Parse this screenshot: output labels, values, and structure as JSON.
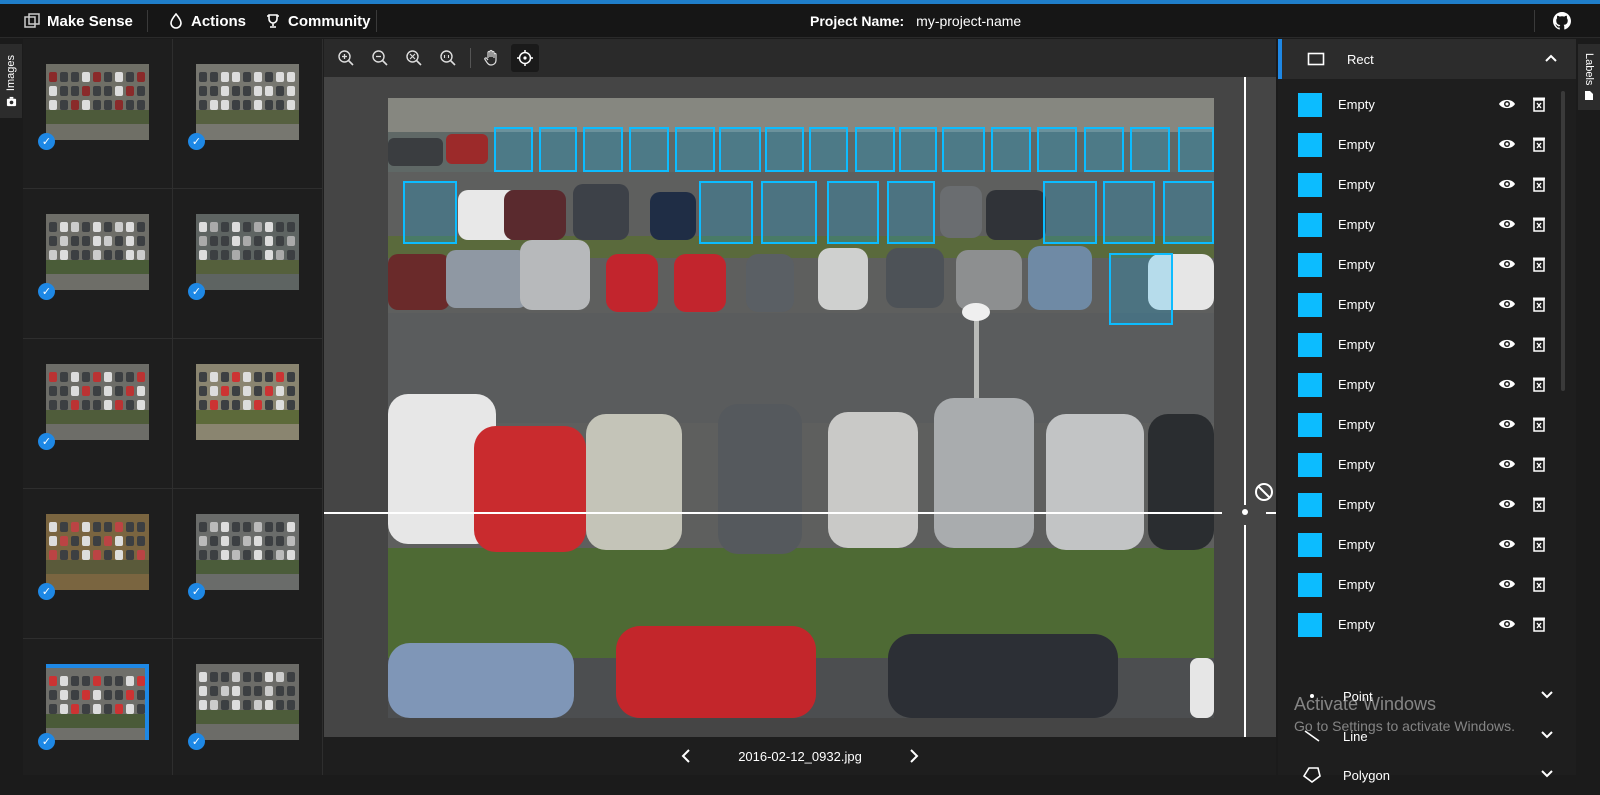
{
  "topbar": {
    "brand": "Make Sense",
    "actions": "Actions",
    "community": "Community",
    "project_label": "Project Name:",
    "project_value": "my-project-name"
  },
  "left_tab": {
    "label": "Images"
  },
  "right_tab": {
    "label": "Labels"
  },
  "thumbnails": [
    {
      "checked": true,
      "selected": false
    },
    {
      "checked": true,
      "selected": false
    },
    {
      "checked": true,
      "selected": false
    },
    {
      "checked": true,
      "selected": false
    },
    {
      "checked": true,
      "selected": false
    },
    {
      "checked": false,
      "selected": false
    },
    {
      "checked": true,
      "selected": false
    },
    {
      "checked": true,
      "selected": false
    },
    {
      "checked": true,
      "selected": true
    },
    {
      "checked": true,
      "selected": false
    }
  ],
  "toolbar": {
    "tools": [
      "zoom-in-icon",
      "zoom-out-icon",
      "zoom-fit-icon",
      "zoom-actual-icon",
      "hand-icon",
      "crosshair-icon"
    ]
  },
  "editor": {
    "filename": "2016-02-12_0932.jpg"
  },
  "labels_panel": {
    "rect_section": "Rect",
    "rect_labels": [
      "Empty",
      "Empty",
      "Empty",
      "Empty",
      "Empty",
      "Empty",
      "Empty",
      "Empty",
      "Empty",
      "Empty",
      "Empty",
      "Empty",
      "Empty",
      "Empty"
    ],
    "point_section": "Point",
    "line_section": "Line",
    "polygon_section": "Polygon",
    "label_color": "#0cbcff"
  },
  "watermark": {
    "line1": "Activate Windows",
    "line2": "Go to Settings to activate Windows."
  },
  "colors": {
    "accent": "#1e88e5",
    "box": "#0cbcff"
  }
}
